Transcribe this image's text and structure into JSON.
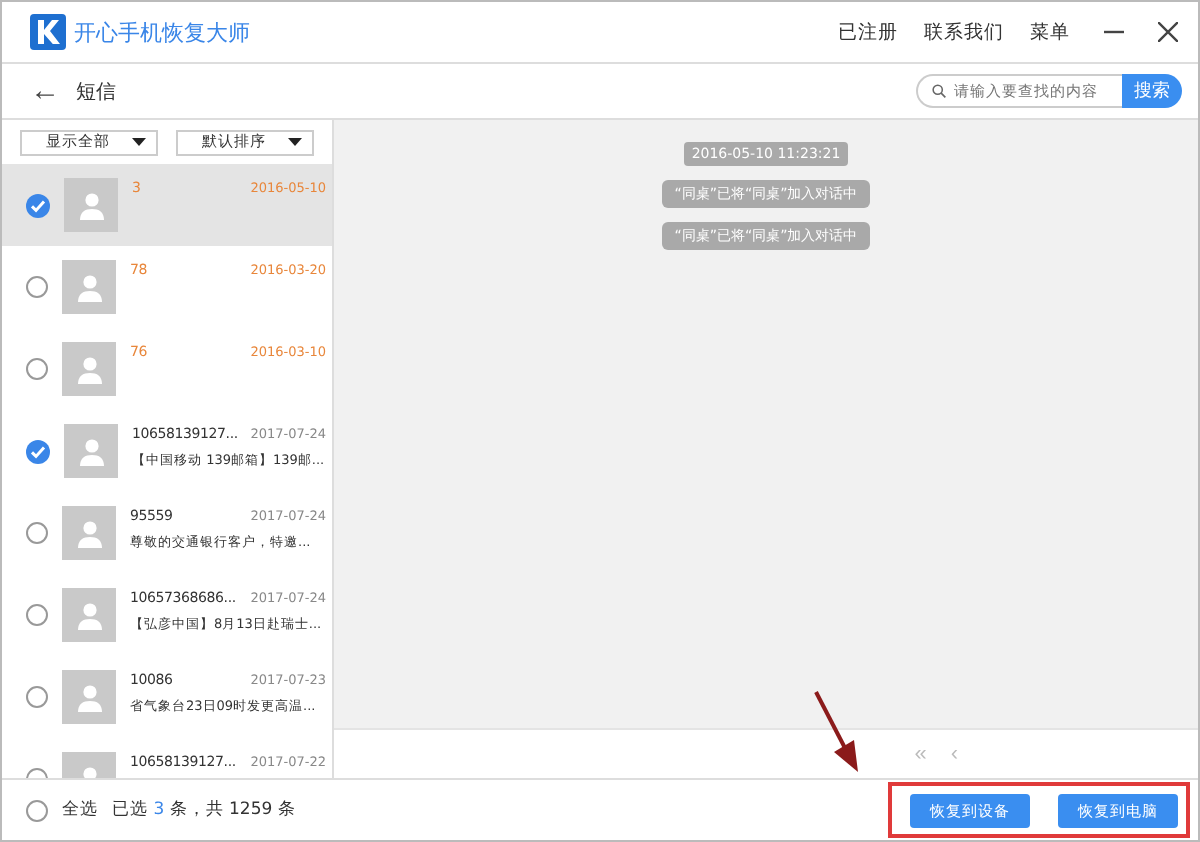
{
  "window": {
    "title": "开心手机恢复大师",
    "menu": [
      "已注册",
      "联系我们",
      "菜单"
    ]
  },
  "header": {
    "back": "←",
    "title": "短信",
    "search": {
      "placeholder": "请输入要查找的内容",
      "button": "搜索"
    }
  },
  "filters": [
    {
      "label": "显示全部"
    },
    {
      "label": "默认排序"
    }
  ],
  "conversations": [
    {
      "kind": "plain",
      "name": "3",
      "date": "2016-05-10",
      "checked": true,
      "selected": true
    },
    {
      "kind": "plain",
      "name": "78",
      "date": "2016-03-20",
      "checked": false,
      "selected": false
    },
    {
      "kind": "plain",
      "name": "76",
      "date": "2016-03-10",
      "checked": false,
      "selected": false
    },
    {
      "kind": "preview",
      "name": "10658139127...",
      "date": "2017-07-24",
      "preview": "【中国移动 139邮箱】139邮...",
      "checked": true,
      "selected": false
    },
    {
      "kind": "preview",
      "name": "95559",
      "date": "2017-07-24",
      "preview": "尊敬的交通银行客户，特邀...",
      "checked": false,
      "selected": false
    },
    {
      "kind": "preview",
      "name": "10657368686...",
      "date": "2017-07-24",
      "preview": "【弘彦中国】8月13日赴瑞士...",
      "checked": false,
      "selected": false
    },
    {
      "kind": "preview",
      "name": "10086",
      "date": "2017-07-23",
      "preview": "省气象台23日09时发更高温...",
      "checked": false,
      "selected": false
    },
    {
      "kind": "preview",
      "name": "10658139127...",
      "date": "2017-07-22",
      "checked": false,
      "selected": false
    }
  ],
  "messages": [
    {
      "kind": "time",
      "text": "2016-05-10 11:23:21"
    },
    {
      "kind": "notice",
      "text": "“同桌”已将“同桌”加入对话中"
    },
    {
      "kind": "notice",
      "text": "“同桌”已将“同桌”加入对话中"
    }
  ],
  "pager": [
    "«",
    "‹"
  ],
  "footer": {
    "select_all": {
      "label": "全选",
      "checked": false
    },
    "summary": "已选 **3** 条，共 1259 条"
  },
  "actions": [
    "恢复到设备",
    "恢复到电脑"
  ]
}
